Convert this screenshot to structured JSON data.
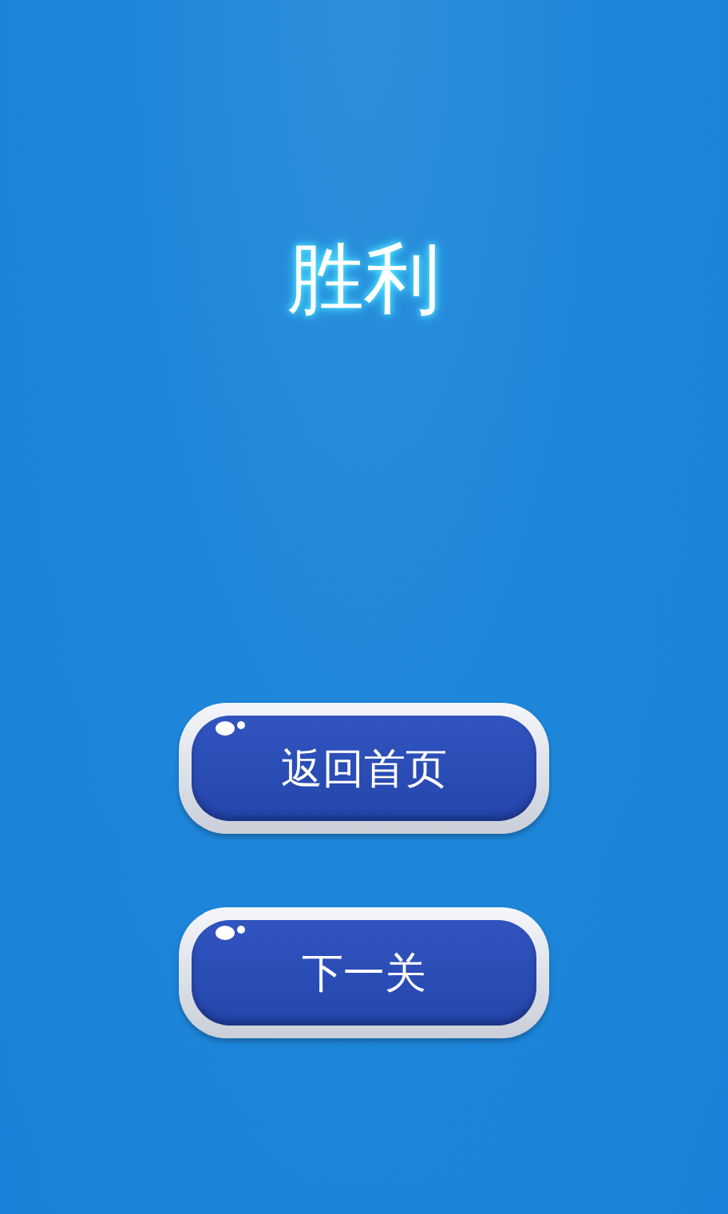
{
  "title": "胜利",
  "buttons": [
    {
      "label": "返回首页"
    },
    {
      "label": "下一关"
    }
  ]
}
